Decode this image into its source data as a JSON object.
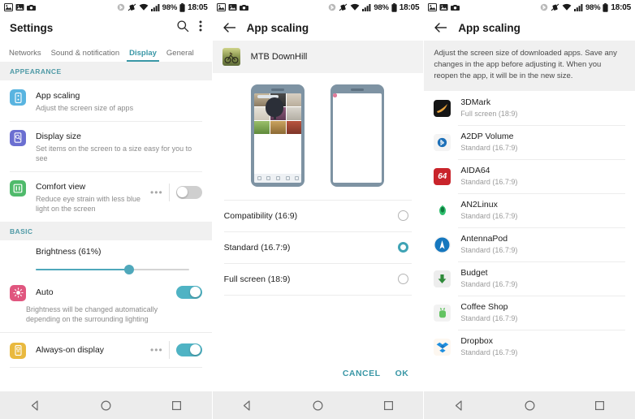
{
  "statusbar": {
    "left_icons": [
      "photo-notification-icon",
      "image-notification-icon",
      "screenshot-notification-icon"
    ],
    "right_icons": [
      "bluetooth-icon",
      "vibrate-off-icon",
      "wifi-icon",
      "signal-icon",
      "battery-icon"
    ],
    "battery_percent": "98%",
    "time": "18:05"
  },
  "navbar": {
    "back_label": "back-nav",
    "home_label": "home-nav",
    "recents_label": "recents-nav"
  },
  "panel1": {
    "title": "Settings",
    "search_icon": "search-icon",
    "overflow_icon": "more-vertical-icon",
    "tabs": [
      {
        "label": "Networks",
        "active": false
      },
      {
        "label": "Sound & notification",
        "active": false
      },
      {
        "label": "Display",
        "active": true
      },
      {
        "label": "General",
        "active": false
      }
    ],
    "sections": [
      {
        "header": "APPEARANCE",
        "rows": [
          {
            "icon": "app-scaling-icon",
            "icon_color": "#59b4e0",
            "title": "App scaling",
            "subtitle": "Adjust the screen size of apps",
            "control": "none"
          },
          {
            "icon": "display-size-icon",
            "icon_color": "#6b6fd1",
            "title": "Display size",
            "subtitle": "Set items on the screen to a size easy for you to see",
            "control": "none"
          },
          {
            "icon": "comfort-view-icon",
            "icon_color": "#4fba6b",
            "title": "Comfort view",
            "subtitle": "Reduce eye strain with less blue light on the screen",
            "control": "toggle",
            "toggle_on": false,
            "has_dots": true
          }
        ]
      }
    ],
    "basic": {
      "header": "BASIC",
      "brightness_label": "Brightness (61%)",
      "brightness_percent": 61,
      "brightness_icon": "brightness-icon",
      "brightness_icon_color": "#e0567f",
      "auto_label": "Auto",
      "auto_toggle_on": true,
      "auto_description": "Brightness will be changed automatically depending on the surrounding lighting",
      "always_on": {
        "icon": "always-on-display-icon",
        "icon_color": "#e9b93f",
        "title": "Always-on display",
        "toggle_on": true,
        "has_dots": true
      }
    }
  },
  "panel2": {
    "back_icon": "arrow-left-icon",
    "title": "App scaling",
    "app": {
      "name": "MTB DownHill",
      "icon": "mtb-downhill-app-icon"
    },
    "preview": {
      "left_phone_label": "standard-ratio-preview",
      "right_phone_label": "full-screen-preview"
    },
    "options": [
      {
        "label": "Compatibility (16:9)",
        "selected": false
      },
      {
        "label": "Standard (16.7:9)",
        "selected": true
      },
      {
        "label": "Full screen (18:9)",
        "selected": false
      }
    ],
    "cancel_label": "CANCEL",
    "ok_label": "OK"
  },
  "panel3": {
    "back_icon": "arrow-left-icon",
    "title": "App scaling",
    "info": "Adjust the screen size of downloaded apps. Save any changes in the app before adjusting it. When you reopen the app, it will be in the new size.",
    "apps": [
      {
        "name": "3DMark",
        "status": "Full screen (18:9)",
        "icon": "3dmark-icon",
        "icon_bg": "#1b1b1b",
        "glyph": ""
      },
      {
        "name": "A2DP Volume",
        "status": "Standard (16.7:9)",
        "icon": "a2dp-volume-icon",
        "icon_bg": "#f5f5f5",
        "glyph": ""
      },
      {
        "name": "AIDA64",
        "status": "Standard (16.7:9)",
        "icon": "aida64-icon",
        "icon_bg": "#c9242b",
        "glyph": "64"
      },
      {
        "name": "AN2Linux",
        "status": "Standard (16.7:9)",
        "icon": "an2linux-icon",
        "icon_bg": "#ffffff",
        "glyph": ""
      },
      {
        "name": "AntennaPod",
        "status": "Standard (16.7:9)",
        "icon": "antennapod-icon",
        "icon_bg": "#0d85c8",
        "glyph": ""
      },
      {
        "name": "Budget",
        "status": "Standard (16.7:9)",
        "icon": "budget-icon",
        "icon_bg": "#eeeeee",
        "glyph": ""
      },
      {
        "name": "Coffee Shop",
        "status": "Standard (16.7:9)",
        "icon": "coffee-shop-icon",
        "icon_bg": "#f2f2f2",
        "glyph": ""
      },
      {
        "name": "Dropbox",
        "status": "Standard (16.7:9)",
        "icon": "dropbox-icon",
        "icon_bg": "#fdf6ef",
        "glyph": ""
      }
    ]
  },
  "colors": {
    "accent_teal": "#3a97a6",
    "toggle_on": "#4fb3c4",
    "section_bg": "#f0f0f0",
    "navbar_bg": "#ececec"
  }
}
